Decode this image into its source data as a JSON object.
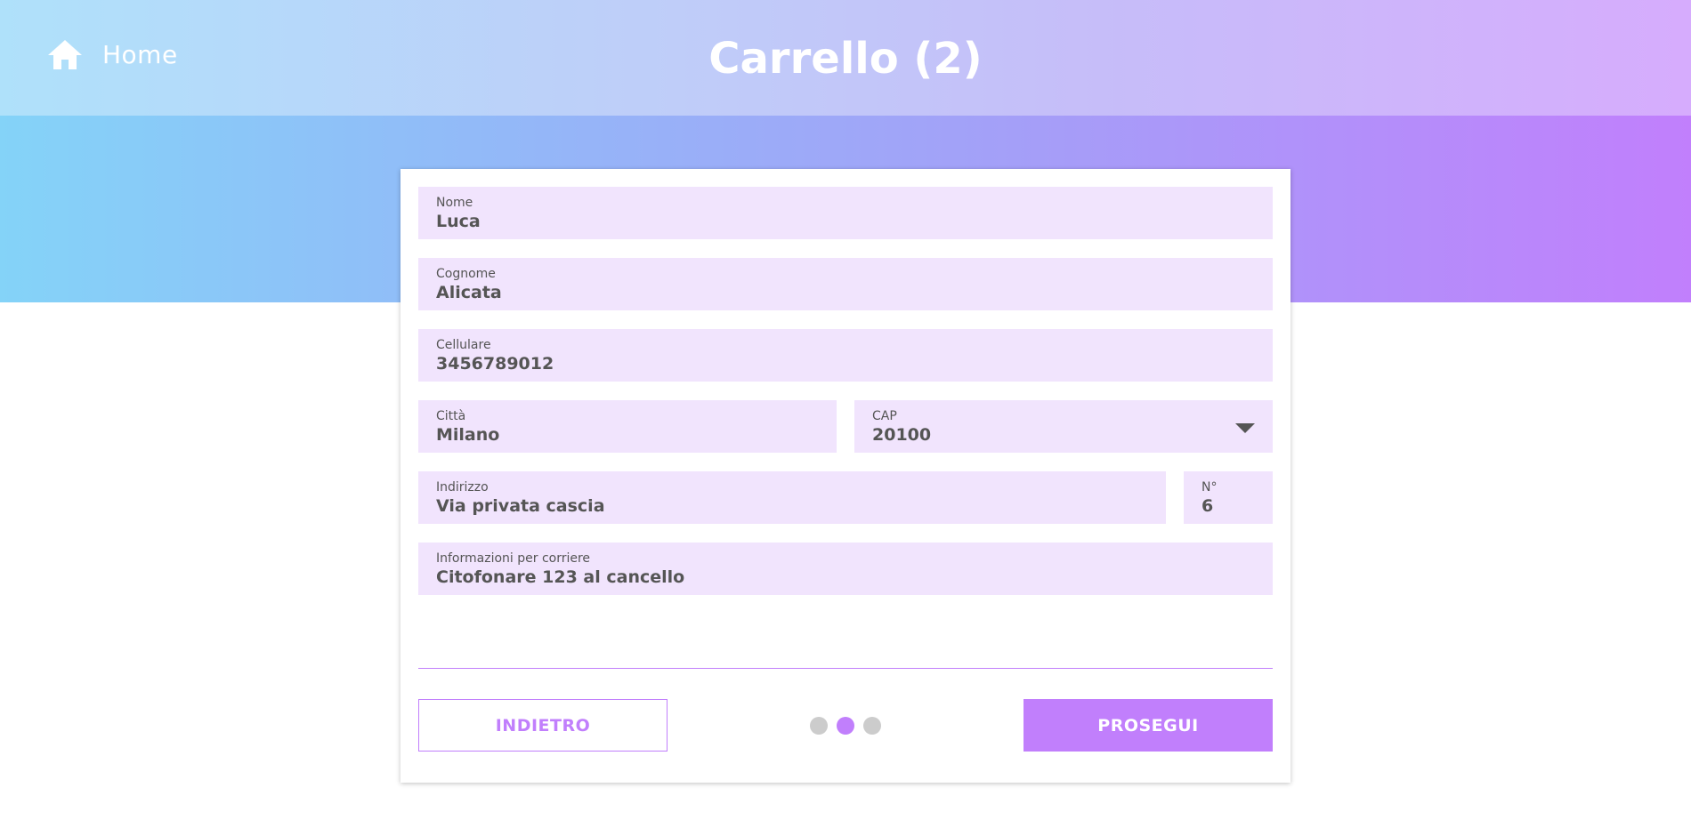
{
  "header": {
    "home_icon": "home-icon",
    "home_label": "Home",
    "title": "Carrello (2)"
  },
  "form": {
    "nome": {
      "label": "Nome",
      "value": "Luca"
    },
    "cognome": {
      "label": "Cognome",
      "value": "Alicata"
    },
    "cellulare": {
      "label": "Cellulare",
      "value": "3456789012"
    },
    "citta": {
      "label": "Città",
      "value": "Milano"
    },
    "cap": {
      "label": "CAP",
      "value": "20100",
      "icon": "chevron-down-icon"
    },
    "indirizzo": {
      "label": "Indirizzo",
      "value": "Via privata cascia"
    },
    "numero": {
      "label": "N°",
      "value": "6"
    },
    "informazioni": {
      "label": "Informazioni per corriere",
      "value": "Citofonare 123 al cancello"
    }
  },
  "footer": {
    "back_label": "INDIETRO",
    "next_label": "PROSEGUI",
    "steps_total": 3,
    "active_step": 2
  },
  "colors": {
    "accent": "#c17ffc",
    "field_background": "#f1e4fd",
    "step_inactive": "#cccccc"
  }
}
